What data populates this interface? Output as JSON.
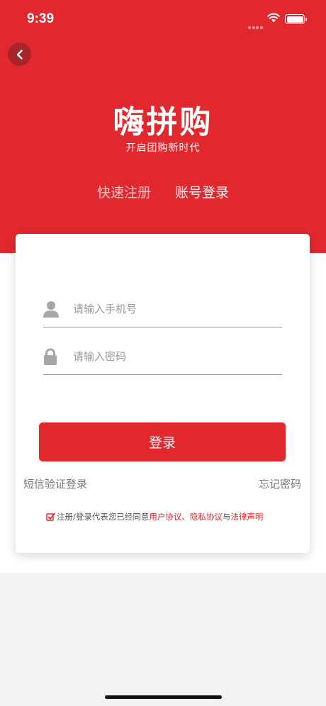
{
  "status_bar": {
    "time": "9:39"
  },
  "header": {
    "brand": "嗨拼购",
    "slogan": "开启团购新时代",
    "back_icon": "chevron-left-icon"
  },
  "tabs": [
    {
      "label": "快速注册",
      "active": false
    },
    {
      "label": "账号登录",
      "active": true
    }
  ],
  "form": {
    "phone_placeholder": "请输入手机号",
    "phone_icon": "user-icon",
    "password_placeholder": "请输入密码",
    "password_icon": "lock-icon",
    "login_label": "登录"
  },
  "links": {
    "sms_login": "短信验证登录",
    "forgot_password": "忘记密码"
  },
  "agreement": {
    "checked": true,
    "prefix": "注册/登录代表您已经同意",
    "user_agreement": "用户协议",
    "separator": "、",
    "privacy_agreement": "隐私协议",
    "and": "与",
    "legal_statement": "法律声明"
  },
  "colors": {
    "brand_red": "#e2282f",
    "link_gray": "#777777",
    "page_bg": "#f2f2f2"
  }
}
